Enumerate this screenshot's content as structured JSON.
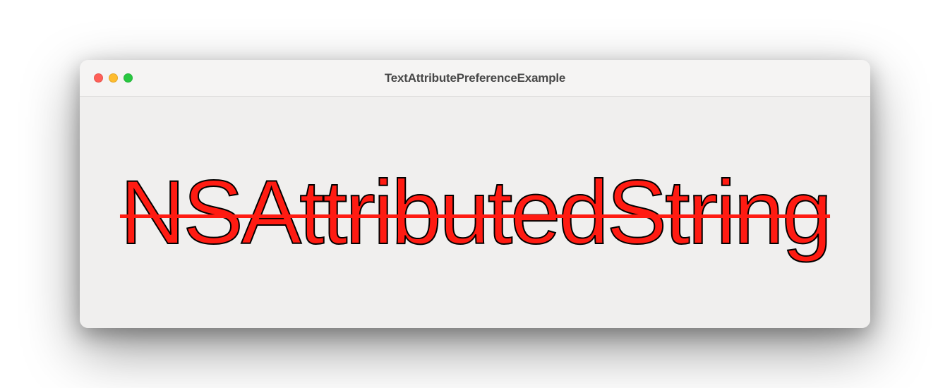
{
  "window": {
    "title": "TextAttributePreferenceExample"
  },
  "content": {
    "attributed_text": "NSAttributedString",
    "text_color": "#ff1b12",
    "stroke_color": "#000000"
  },
  "traffic_lights": {
    "close": "close",
    "minimize": "minimize",
    "maximize": "maximize"
  }
}
